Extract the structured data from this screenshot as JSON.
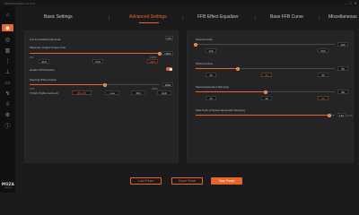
{
  "app": {
    "title": "MOZA Pit House 1.2.4.16"
  },
  "window_controls": {
    "minimize": "–",
    "maximize": "□",
    "close": "✕"
  },
  "brand": {
    "logo": "MOZA",
    "sub": "RACING"
  },
  "colors": {
    "accent": "#e8652b",
    "background": "#1b1b1d",
    "panel": "#242427"
  },
  "sidebar": {
    "items": [
      {
        "icon": "home-icon",
        "glyph": "⌂"
      },
      {
        "icon": "wheelbase-icon",
        "glyph": "◉",
        "active": true
      },
      {
        "icon": "steering-wheel-icon",
        "glyph": "◎"
      },
      {
        "icon": "pedals-icon",
        "glyph": "▥"
      },
      {
        "icon": "shifter-icon",
        "glyph": "⋮"
      },
      {
        "icon": "handbrake-icon",
        "glyph": "⊥"
      },
      {
        "icon": "dashboard-icon",
        "glyph": "▭"
      },
      {
        "icon": "stalks-icon",
        "glyph": "↯"
      },
      {
        "icon": "firmware-icon",
        "glyph": "⇩"
      },
      {
        "icon": "settings-icon",
        "glyph": "⚙"
      },
      {
        "icon": "info-icon",
        "glyph": "ⓘ"
      }
    ]
  },
  "tabs": [
    {
      "label": "Basic Settings"
    },
    {
      "label": "Advanced Settings",
      "active": true
    },
    {
      "label": "FFB Effect Equalizer"
    },
    {
      "label": "Base FFB Curve"
    },
    {
      "label": "Miscellaneous"
    }
  ],
  "left_panel": {
    "ffb_reverse": {
      "label": "Force Feedback Reversal",
      "state": "OFF"
    },
    "max_torque": {
      "label": "Maximum Output Torque Limit",
      "value": "100%",
      "level": 1.0,
      "presets": [
        "40%",
        "70%",
        "100%"
      ],
      "min": "0%",
      "max": "100%"
    },
    "hands_off": {
      "label": "Hands-Off Protection",
      "enabled": true
    },
    "steering_inertia": {
      "label": "Steering Wheel Inertia",
      "value": "2800",
      "level": 0.58,
      "min": "100",
      "max": "4000",
      "presets": [
        "Low",
        "Mid",
        "High"
      ],
      "preset_label": "TC/GS Profile Inertia 10",
      "preset_value": "RS 215"
    }
  },
  "right_panel": {
    "natural_inertia": {
      "label": "Natural Inertia",
      "value": "100",
      "level": 0.0,
      "min": "100",
      "max": "500"
    },
    "wheel_friction": {
      "label": "Wheel Friction",
      "value": "30",
      "level": 0.3,
      "min": "0",
      "max": "100",
      "presets": [
        "10",
        "30",
        "50"
      ],
      "active_preset": "30"
    },
    "speed_damping": {
      "label": "Speed-dependent Damping",
      "value": "50",
      "level": 0.5,
      "min": "0",
      "max": "100",
      "presets": [
        "10",
        "30",
        "50"
      ],
      "active_preset": "50"
    },
    "speed_damping_start": {
      "label": "Start Point of Speed-dependent Damping",
      "value": "120",
      "unit": "km/h",
      "level": 0.96,
      "min": "0",
      "max": ""
    }
  },
  "footer": {
    "load_preset": "Load Preset",
    "export_preset": "Export Preset",
    "save_preset": "Save Preset"
  }
}
